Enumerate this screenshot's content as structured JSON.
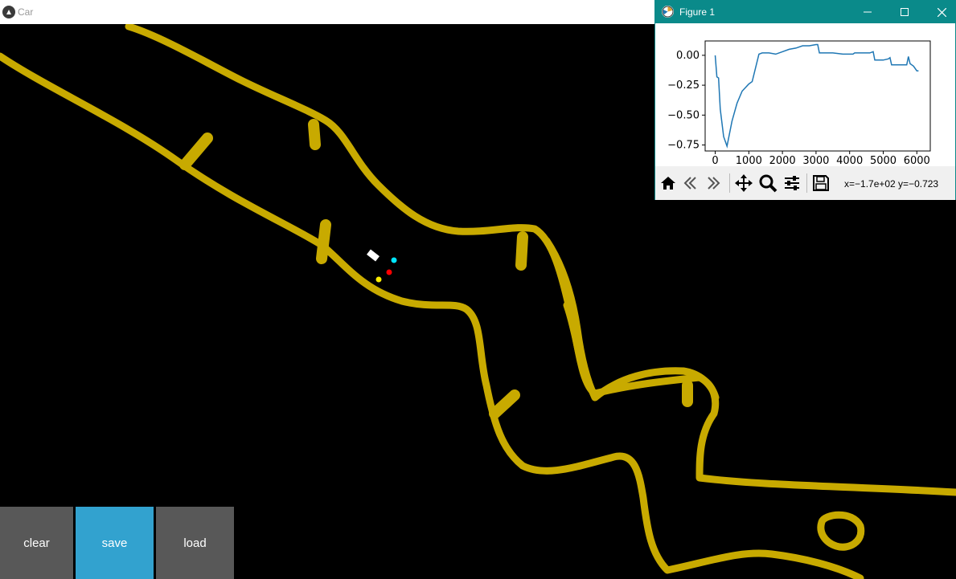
{
  "main_window": {
    "title": "Car",
    "icon": "kivy-icon"
  },
  "buttons": {
    "clear": "clear",
    "save": "save",
    "load": "load"
  },
  "colors": {
    "track": "#c8aa00",
    "background": "#000000",
    "button_gray": "#585858",
    "button_blue": "#32a2cf",
    "sensor_cyan": "#00e5ff",
    "sensor_red": "#ff0000",
    "sensor_yellow": "#ffee00",
    "car": "#ffffff",
    "figure_titlebar": "#0a8a8a",
    "plot_line": "#1f77b4"
  },
  "figure_window": {
    "title": "Figure 1",
    "icon": "matplotlib-icon",
    "controls": [
      "minimize-icon",
      "maximize-icon",
      "close-icon"
    ],
    "toolbar_icons": [
      "home-icon",
      "back-icon",
      "forward-icon",
      "pan-icon",
      "zoom-icon",
      "configure-icon",
      "save-icon"
    ],
    "coord_readout": "x=−1.7e+02 y=−0.723"
  },
  "chart_data": {
    "type": "line",
    "title": "",
    "xlabel": "",
    "ylabel": "",
    "xlim": [
      -300,
      6400
    ],
    "ylim": [
      -0.8,
      0.12
    ],
    "x_ticks": [
      "0",
      "1000",
      "2000",
      "3000",
      "4000",
      "5000",
      "6000"
    ],
    "y_ticks": [
      "0.00",
      "−0.25",
      "−0.50",
      "−0.75"
    ],
    "grid": false,
    "series": [
      {
        "color": "#1f77b4",
        "x": [
          0,
          50,
          100,
          150,
          250,
          350,
          500,
          650,
          800,
          1000,
          1100,
          1300,
          1400,
          1600,
          1800,
          2000,
          2200,
          2400,
          2600,
          2800,
          3000,
          3050,
          3100,
          3500,
          3800,
          4100,
          4150,
          4300,
          4600,
          4700,
          4750,
          5000,
          5150,
          5200,
          5250,
          5400,
          5500,
          5700,
          5750,
          5800,
          5900,
          6000,
          6050
        ],
        "y": [
          0.0,
          -0.18,
          -0.19,
          -0.45,
          -0.68,
          -0.76,
          -0.55,
          -0.4,
          -0.3,
          -0.24,
          -0.22,
          0.01,
          0.02,
          0.02,
          0.01,
          0.03,
          0.05,
          0.06,
          0.08,
          0.08,
          0.09,
          0.09,
          0.02,
          0.02,
          0.01,
          0.01,
          0.02,
          0.02,
          0.02,
          0.03,
          -0.04,
          -0.04,
          -0.03,
          -0.02,
          -0.08,
          -0.08,
          -0.08,
          -0.08,
          -0.01,
          -0.07,
          -0.09,
          -0.13,
          -0.13
        ]
      }
    ]
  }
}
